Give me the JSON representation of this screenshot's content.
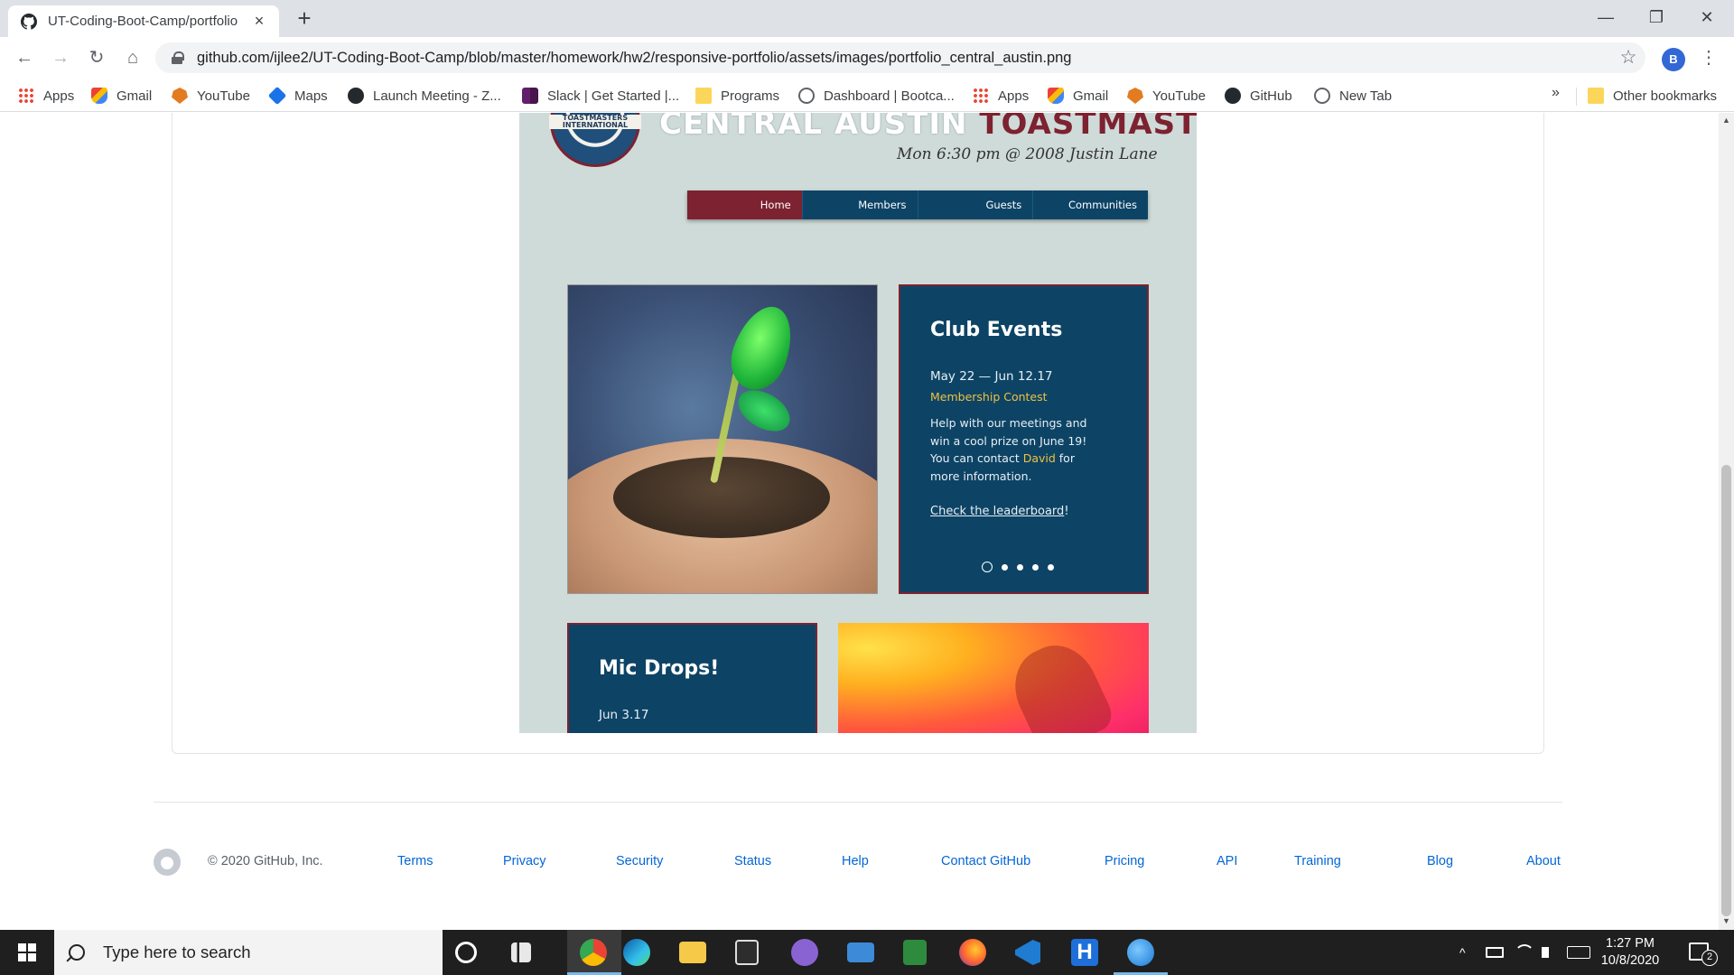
{
  "browser": {
    "tab": {
      "title": "UT-Coding-Boot-Camp/portfolio",
      "close": "×"
    },
    "new_tab": "+",
    "window_controls": {
      "minimize": "—",
      "maximize": "❐",
      "close": "✕"
    },
    "nav": {
      "back": "←",
      "forward": "→",
      "reload": "↻",
      "home": "⌂"
    },
    "url": "github.com/ijlee2/UT-Coding-Boot-Camp/blob/master/homework/hw2/responsive-portfolio/assets/images/portfolio_central_austin.png",
    "profile_initial": "B",
    "star": "☆",
    "menu": "⋮",
    "bookmarks": [
      {
        "label": "Apps",
        "icon": "apps-icon"
      },
      {
        "label": "Gmail",
        "icon": "gmail-icon"
      },
      {
        "label": "YouTube",
        "icon": "youtube-icon"
      },
      {
        "label": "Maps",
        "icon": "maps-icon"
      },
      {
        "label": "Launch Meeting - Z...",
        "icon": "github-icon"
      },
      {
        "label": "Slack | Get Started |...",
        "icon": "slack-icon"
      },
      {
        "label": "Programs",
        "icon": "folder-icon"
      },
      {
        "label": "Dashboard | Bootca...",
        "icon": "globe-icon"
      },
      {
        "label": "Apps",
        "icon": "apps-icon"
      },
      {
        "label": "Gmail",
        "icon": "gmail-icon"
      },
      {
        "label": "YouTube",
        "icon": "youtube-icon"
      },
      {
        "label": "GitHub",
        "icon": "github-icon"
      },
      {
        "label": "New Tab",
        "icon": "globe-icon"
      }
    ],
    "bookmarks_more": "»",
    "other_bookmarks": "Other bookmarks"
  },
  "portfolio_image": {
    "logo_text": "TOASTMASTERS INTERNATIONAL",
    "title_part1": "CENTRAL AUSTIN",
    "title_part2": "TOASTMASTERS",
    "subtitle": "Mon 6:30 pm @ 2008 Justin Lane",
    "nav": [
      "Home",
      "Members",
      "Guests",
      "Communities"
    ],
    "club_events": {
      "heading": "Club Events",
      "date": "May 22 — Jun 12.17",
      "event": "Membership Contest",
      "desc_1": "Help with our meetings and win a cool prize on June 19! You can contact ",
      "desc_name": "David",
      "desc_2": " for more information.",
      "link": "Check the leaderboard",
      "link_suffix": "!"
    },
    "mic_drops": {
      "heading": "Mic Drops!",
      "date": "Jun 3.17"
    }
  },
  "footer": {
    "copyright": "© 2020 GitHub, Inc.",
    "links": [
      "Terms",
      "Privacy",
      "Security",
      "Status",
      "Help",
      "Contact GitHub",
      "Pricing",
      "API",
      "Training",
      "Blog",
      "About"
    ]
  },
  "taskbar": {
    "search_placeholder": "Type here to search",
    "time": "1:27 PM",
    "date": "10/8/2020",
    "notification_count": "2",
    "tray_chevron": "^"
  },
  "colors": {
    "toastmasters_blue": "#0d4466",
    "toastmasters_maroon": "#7d2230",
    "github_link": "#0366d6"
  }
}
